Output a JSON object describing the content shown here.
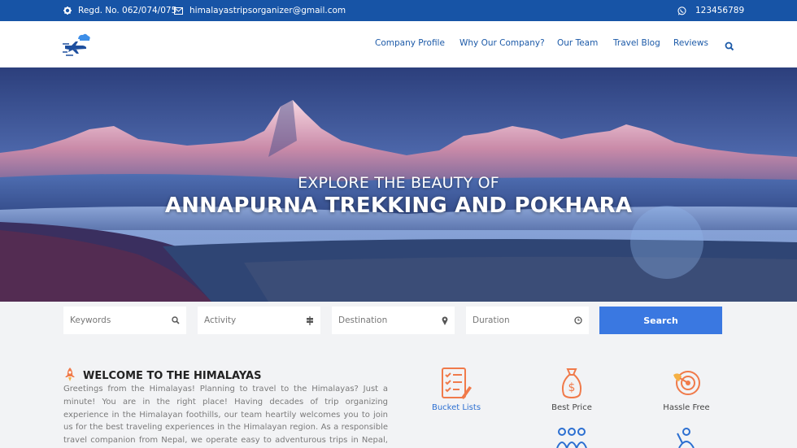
{
  "topbar": {
    "regd": "Regd. No. 062/074/075",
    "email": "himalayastripsorganizer@gmail.com",
    "phone": "123456789"
  },
  "nav": {
    "items": [
      "Company Profile",
      "Why Our Company?",
      "Our Team",
      "Travel Blog",
      "Reviews"
    ]
  },
  "hero": {
    "subtitle": "EXPLORE THE BEAUTY OF",
    "title": "ANNAPURNA TREKKING AND POKHARA"
  },
  "search": {
    "keywords_placeholder": "Keywords",
    "activity_placeholder": "Activity",
    "destination_placeholder": "Destination",
    "duration_placeholder": "Duration",
    "button_label": "Search"
  },
  "welcome": {
    "title": "WELCOME TO THE HIMALAYAS",
    "text": "Greetings from the Himalayas! Planning to travel to the Himalayas? Just a minute! You are in the right place! Having decades of trip organizing experience in the Himalayan foothills, our team heartily welcomes you to join us for the best traveling experiences in the Himalayan region. As a responsible travel companion from Nepal, we operate easy to adventurous trips in Nepal, Tibet, and Bhutan as per your"
  },
  "features": [
    {
      "label": "Bucket Lists",
      "icon": "checklist-icon"
    },
    {
      "label": "Best Price",
      "icon": "money-bag-icon"
    },
    {
      "label": "Hassle Free",
      "icon": "target-icon"
    }
  ],
  "colors": {
    "topbar": "#1754a6",
    "nav_link": "#1c5aa8",
    "search_button": "#3a78e1",
    "feature_icon": "#f07a4a",
    "feature_active": "#2c6fd1"
  }
}
